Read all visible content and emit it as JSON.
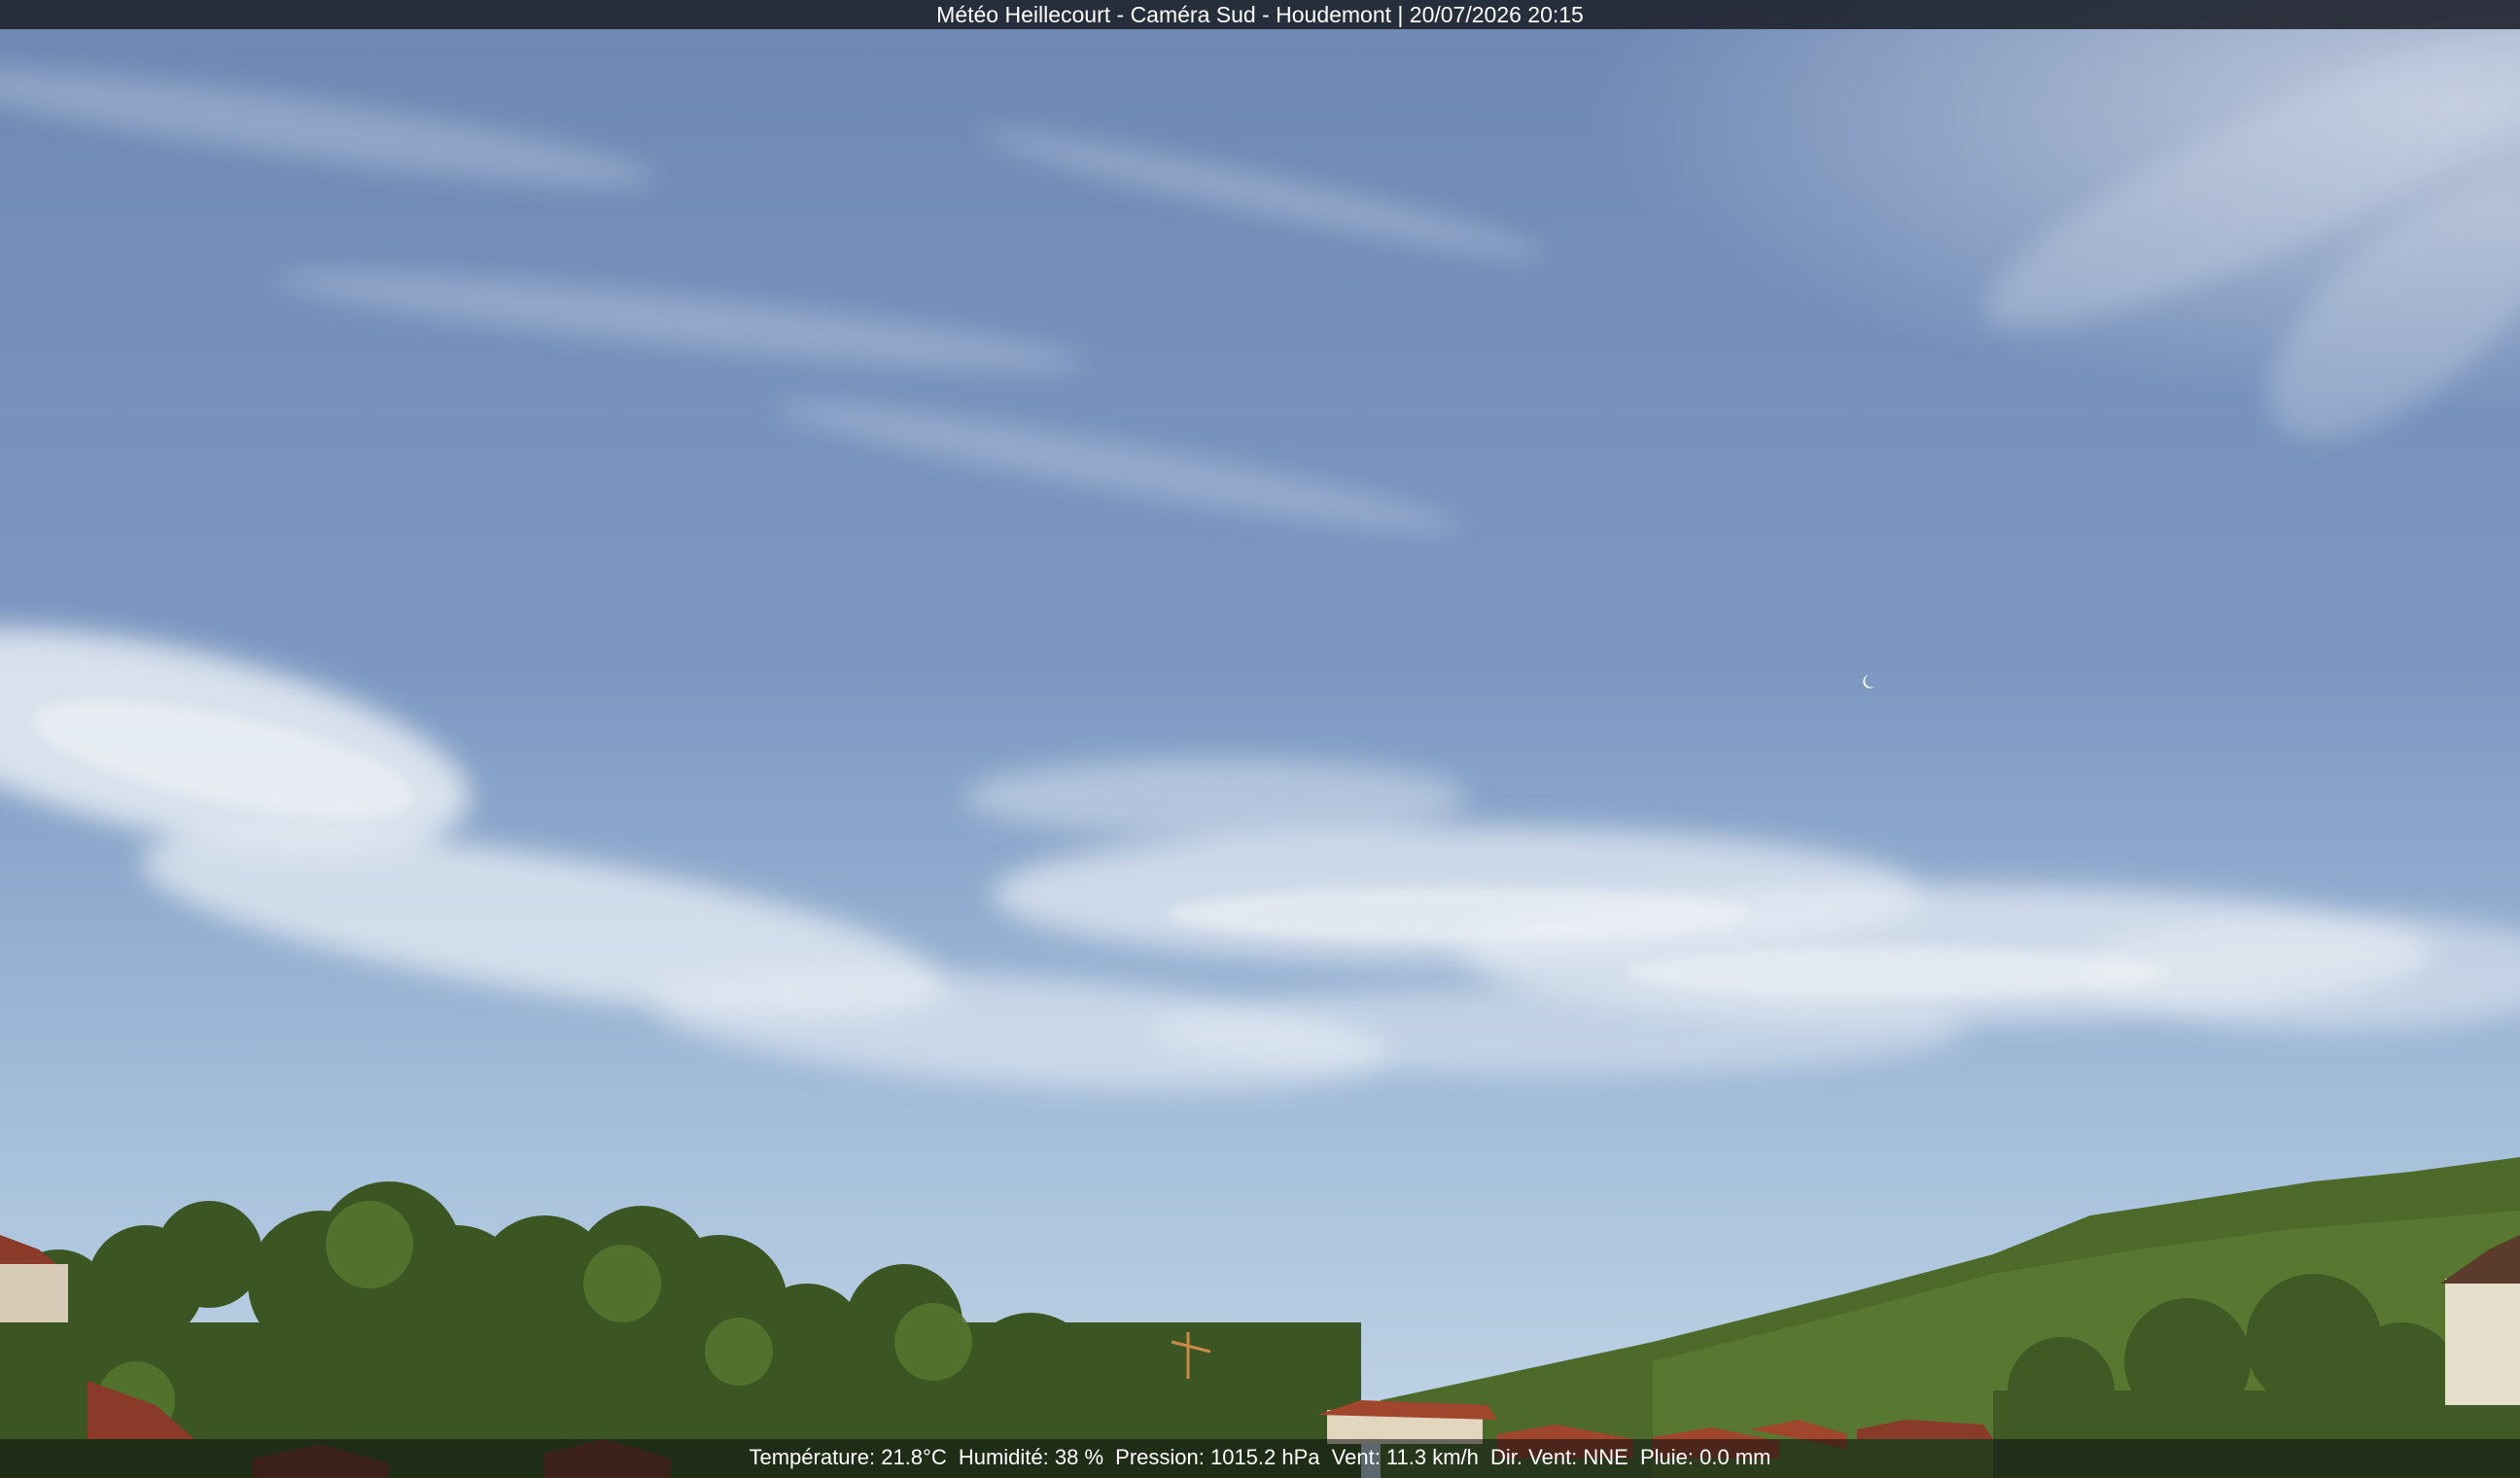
{
  "header": {
    "title": "Météo Heillecourt - Caméra Sud - Houdemont | 20/07/2026 20:15"
  },
  "readings": {
    "temperature": "Température: 21.8°C",
    "humidity": "Humidité: 38 %",
    "pressure": "Pression: 1015.2 hPa",
    "wind": "Vent: 11.3 km/h",
    "wind_dir": "Dir. Vent: NNE",
    "rain": "Pluie: 0.0 mm"
  },
  "colors": {
    "sky_top": "#6c87b4",
    "sky_horizon": "#b8cfe3",
    "cloud": "#e6ecf2",
    "trees": "#3f5a24",
    "roofs": "#8a3a28"
  }
}
